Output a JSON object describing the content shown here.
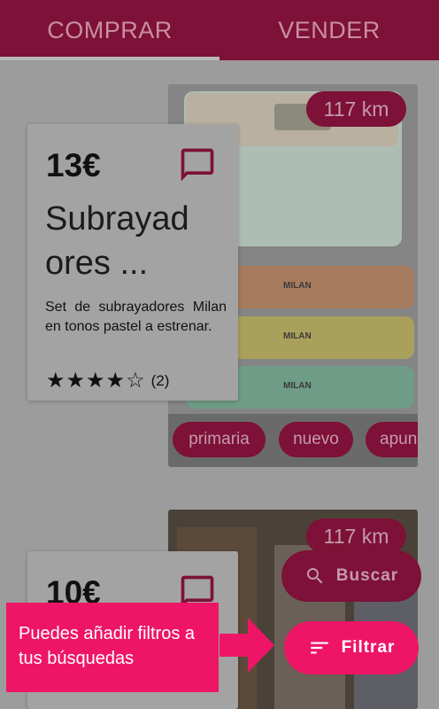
{
  "tabs": [
    {
      "label": "COMPRAR",
      "selected": true
    },
    {
      "label": "VENDER",
      "selected": false
    }
  ],
  "products": [
    {
      "distance": "117 km",
      "price": "13€",
      "title": "Subrayad\nores ...",
      "description": "Set de subrayadores Milan en tonos pastel a estrenar.",
      "rating_stars": "★★★★☆",
      "rating_value": 4,
      "rating_count": "(2)",
      "tags": [
        "primaria",
        "nuevo",
        "apun"
      ],
      "photo_text": "MILAN"
    },
    {
      "distance": "117 km",
      "price": "10€"
    }
  ],
  "actions": {
    "search_label": "Buscar",
    "filter_label": "Filtrar"
  },
  "tooltip": {
    "text": "Puedes añadir filtros a tus búsquedas"
  },
  "colors": {
    "primary": "#7d1137",
    "accent": "#ee1566"
  }
}
